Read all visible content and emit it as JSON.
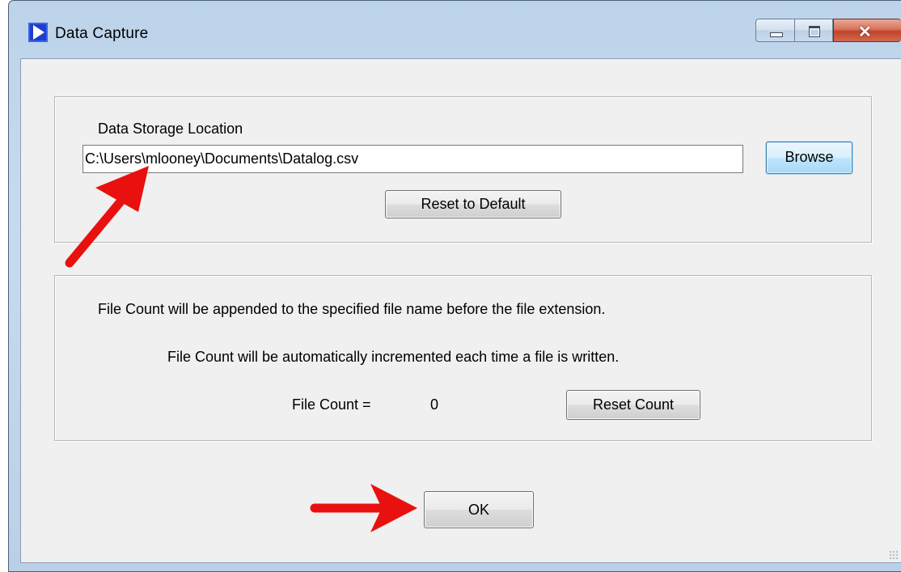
{
  "window": {
    "title": "Data Capture",
    "icon": "play-triangle-icon",
    "controls": [
      "minimize-icon",
      "maximize-icon",
      "close-icon"
    ]
  },
  "storage": {
    "group_label": "Data Storage Location",
    "path_value": "C:\\Users\\mlooney\\Documents\\Datalog.csv",
    "browse_label": "Browse",
    "reset_default_label": "Reset to Default"
  },
  "file_count": {
    "note_append": "File Count will be appended to the specified file name before the file extension.",
    "note_increment": "File Count will be automatically incremented each time a file is written.",
    "count_label": "File Count =",
    "count_value": "0",
    "reset_count_label": "Reset Count"
  },
  "footer": {
    "ok_label": "OK"
  },
  "annotations": {
    "arrow_color": "#e8110f",
    "arrows": [
      "arrow-to-path-field",
      "arrow-to-ok-button"
    ]
  },
  "colors": {
    "client_bg": "#f0f0f0",
    "frame": "#c2d6ec",
    "close_button": "#c7462c",
    "browse_focus": "#3c7fb1"
  }
}
